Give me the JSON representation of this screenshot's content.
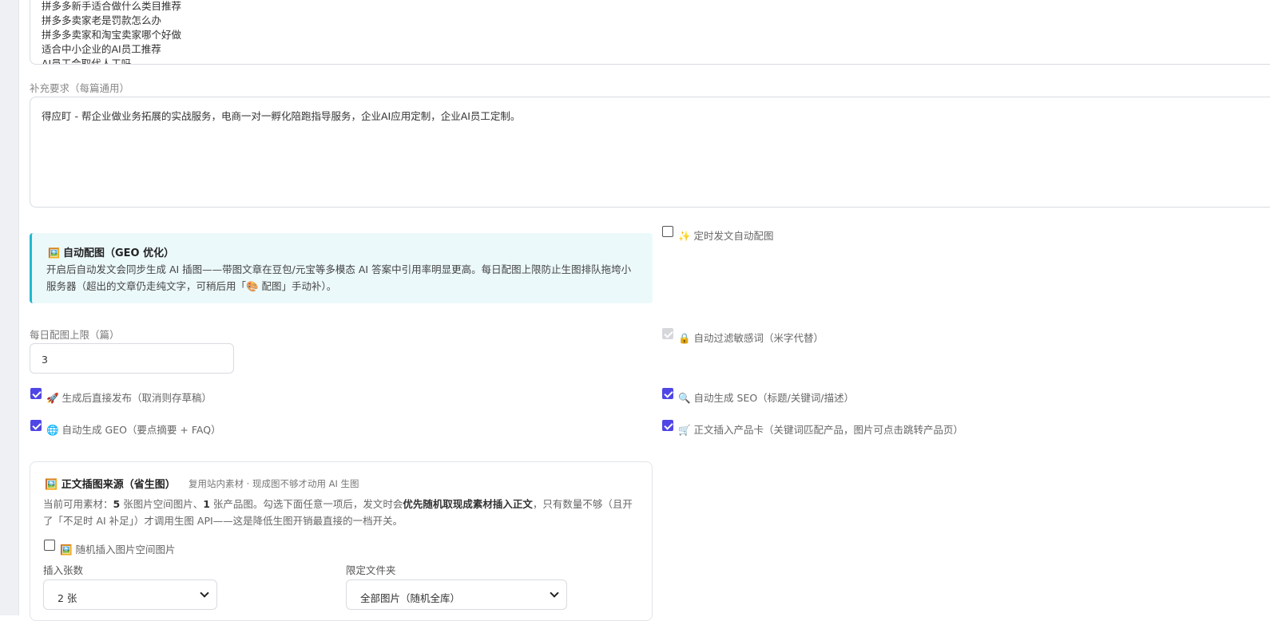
{
  "topics": {
    "lines": [
      "拼多多新手适合做什么类目推荐",
      "拼多多卖家老是罚款怎么办",
      "拼多多卖家和淘宝卖家哪个好做",
      "适合中小企业的AI员工推荐",
      "AI员工会取代人工吗"
    ]
  },
  "requirements": {
    "label": "补充要求（每篇通用）",
    "value": "得应盯 - 帮企业做业务拓展的实战服务，电商一对一孵化陪跑指导服务，企业AI应用定制，企业AI员工定制。"
  },
  "auto_image": {
    "icon": "picture-icon",
    "title": "自动配图（GEO 优化）",
    "description": "开启后自动发文会同步生成 AI 插图——带图文章在豆包/元宝等多模态 AI 答案中引用率明显更高。每日配图上限防止生图排队拖垮小服务器（超出的文章仍走纯文字，可稍后用「🎨 配图」手动补）。"
  },
  "daily_limit": {
    "label": "每日配图上限（篇）",
    "value": "3"
  },
  "checkboxes": {
    "scheduled_image": {
      "label": "✨ 定时发文自动配图",
      "checked": false
    },
    "filter_sensitive": {
      "label": "🔒 自动过滤敏感词（米字代替）",
      "checked": true,
      "disabled": true
    },
    "publish_direct": {
      "label": "🚀 生成后直接发布（取消则存草稿）",
      "checked": true
    },
    "auto_seo": {
      "label": "🔍 自动生成 SEO（标题/关键词/描述）",
      "checked": true
    },
    "auto_geo": {
      "label": "🌐 自动生成 GEO（要点摘要 + FAQ）",
      "checked": true
    },
    "insert_product_card": {
      "label": "🛒 正文插入产品卡（关键词匹配产品，图片可点击跳转产品页）",
      "checked": true
    }
  },
  "image_source": {
    "title": "🖼️ 正文插图来源（省生图）",
    "subtitle": "复用站内素材 · 现成图不够才动用 AI 生图",
    "desc_prefix": "当前可用素材：",
    "desc_count1": "5",
    "desc_mid1": " 张图片空间图片、",
    "desc_count2": "1",
    "desc_mid2": " 张产品图。勾选下面任意一项后，发文时会",
    "desc_bold": "优先随机取现成素材插入正文",
    "desc_suffix": "，只有数量不够（且开了「不足时 AI 补足」）才调用生图 API——这是降低生图开销最直接的一档开关。",
    "random_insert_label": "🖼️ 随机插入图片空间图片",
    "random_insert_checked": false,
    "count_label": "插入张数",
    "count_value": "2 张",
    "folder_label": "限定文件夹",
    "folder_value": "全部图片（随机全库）"
  },
  "colors": {
    "accent": "#4f46e5",
    "info_bg": "#ecf9fb",
    "info_border": "#22b8cf"
  }
}
